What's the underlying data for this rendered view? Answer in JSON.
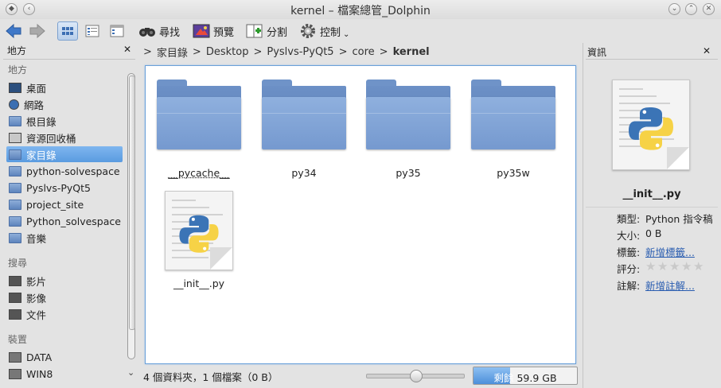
{
  "window": {
    "title": "kernel – 檔案總管_Dolphin"
  },
  "toolbar": {
    "find_label": "尋找",
    "preview_label": "預覽",
    "split_label": "分割",
    "control_label": "控制"
  },
  "places_panel": {
    "header": "地方",
    "sections": {
      "places": "地方",
      "search": "搜尋",
      "devices": "裝置"
    },
    "places_items": [
      {
        "label": "桌面",
        "icon": "desktop-icon"
      },
      {
        "label": "網路",
        "icon": "network-icon"
      },
      {
        "label": "根目錄",
        "icon": "root-folder-icon"
      },
      {
        "label": "資源回收桶",
        "icon": "trash-icon"
      },
      {
        "label": "家目錄",
        "icon": "home-icon",
        "selected": true
      },
      {
        "label": "python-solvespace",
        "icon": "folder-icon"
      },
      {
        "label": "Pyslvs-PyQt5",
        "icon": "folder-icon"
      },
      {
        "label": "project_site",
        "icon": "folder-icon"
      },
      {
        "label": "Python_solvespace",
        "icon": "folder-icon"
      },
      {
        "label": "音樂",
        "icon": "music-folder-icon"
      }
    ],
    "search_items": [
      {
        "label": "影片",
        "icon": "video-icon"
      },
      {
        "label": "影像",
        "icon": "image-icon"
      },
      {
        "label": "文件",
        "icon": "document-icon"
      }
    ],
    "device_items": [
      {
        "label": "DATA",
        "icon": "drive-icon"
      },
      {
        "label": "WIN8",
        "icon": "drive-icon"
      }
    ]
  },
  "breadcrumb": [
    "家目錄",
    "Desktop",
    "Pyslvs-PyQt5",
    "core",
    "kernel"
  ],
  "files": [
    {
      "name": "__pycache__",
      "type": "folder"
    },
    {
      "name": "py34",
      "type": "folder"
    },
    {
      "name": "py35",
      "type": "folder"
    },
    {
      "name": "py35w",
      "type": "folder"
    },
    {
      "name": "__init__.py",
      "type": "python"
    }
  ],
  "status": {
    "summary": "4 個資料夾，1 個檔案（0 B）",
    "zoom_fraction": 0.5,
    "free_label": "剩餘",
    "free_space": "59.9 GB",
    "usage_fraction": 0.35
  },
  "info_panel": {
    "header": "資訊",
    "filename": "__init__.py",
    "rows": {
      "type_key": "類型:",
      "type_val": "Python 指令稿",
      "size_key": "大小:",
      "size_val": "0 B",
      "tags_key": "標籤:",
      "tags_val": "新增標籤...",
      "rating_key": "評分:",
      "rating_stars": 0,
      "comment_key": "註解:",
      "comment_val": "新增註解..."
    }
  },
  "colors": {
    "accent": "#5a9be0",
    "folder": "#7599cf",
    "link": "#2a5db0"
  }
}
